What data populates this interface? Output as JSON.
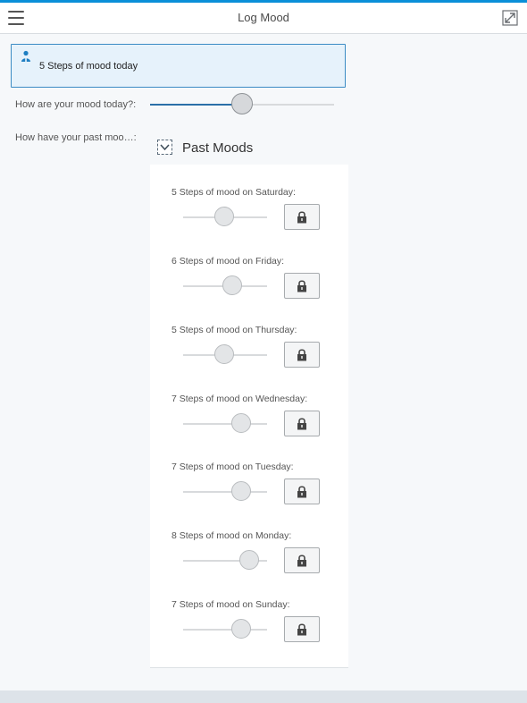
{
  "header": {
    "title": "Log Mood",
    "menu_icon": "hamburger-menu-icon",
    "expand_icon": "expand-icon"
  },
  "info": {
    "icon": "person-icon",
    "text": "5 Steps of mood today"
  },
  "today": {
    "label": "How are your mood today?:",
    "value": 5,
    "min": 0,
    "max": 10
  },
  "past": {
    "label": "How have your past moo…:",
    "panel_title": "Past Moods",
    "collapse_icon": "chevron-down-icon",
    "items": [
      {
        "label": "5 Steps of mood on Saturday:",
        "value": 5
      },
      {
        "label": "6 Steps of mood on Friday:",
        "value": 6
      },
      {
        "label": "5 Steps of mood on Thursday:",
        "value": 5
      },
      {
        "label": "7 Steps of mood on Wednesday:",
        "value": 7
      },
      {
        "label": "7 Steps of mood on Tuesday:",
        "value": 7
      },
      {
        "label": "8 Steps of mood on Monday:",
        "value": 8
      },
      {
        "label": "7 Steps of mood on Sunday:",
        "value": 7
      }
    ],
    "lock_icon": "lock-icon"
  },
  "colors": {
    "accent": "#0a8fd8",
    "slider_fill": "#2a6fa8",
    "info_border": "#3b8bc4",
    "info_bg": "#e6f2fb"
  }
}
